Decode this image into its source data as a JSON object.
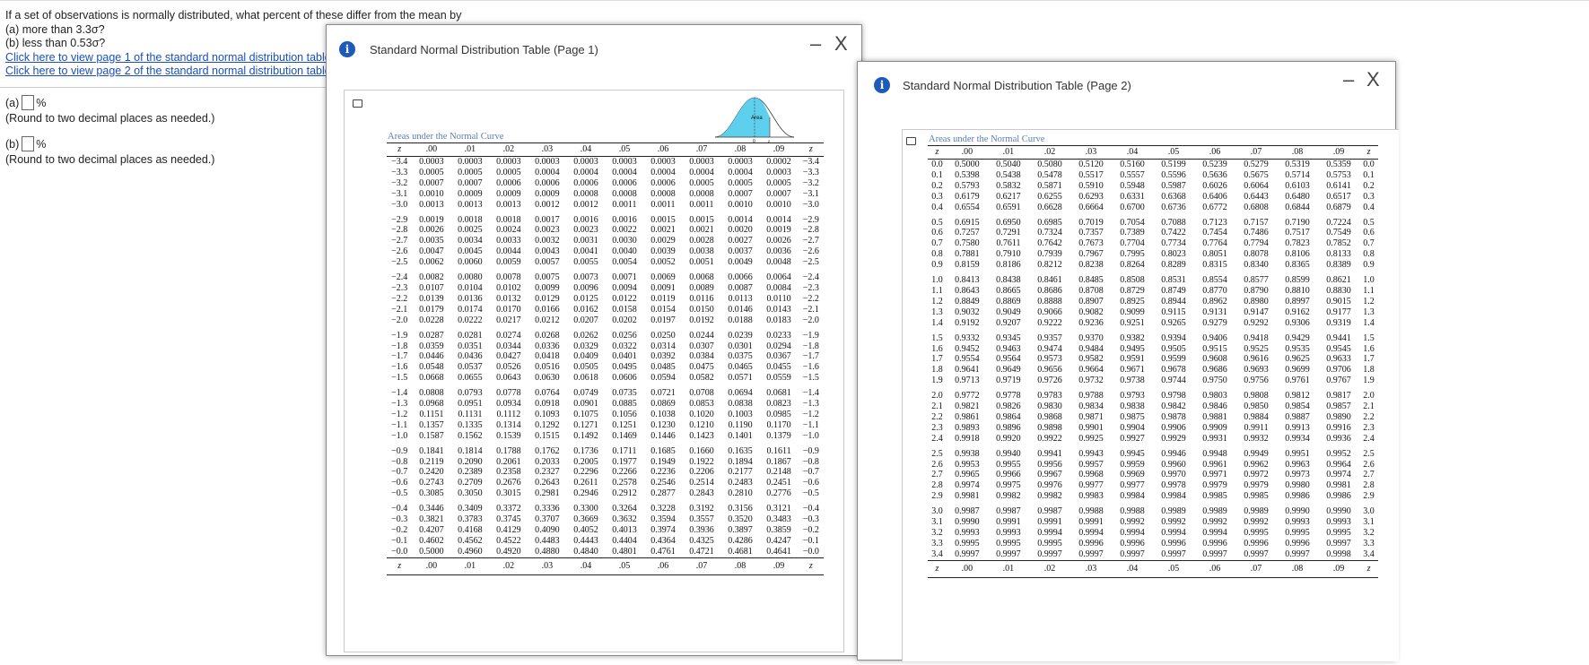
{
  "question": {
    "text": "If a set of observations is normally distributed, what percent of these differ from the mean by",
    "part_a": "(a) more than 3.3σ?",
    "part_b": "(b) less than 0.53σ?",
    "link1": "Click here to view page 1 of the standard normal distribution table.",
    "link2": "Click here to view page 2 of the standard normal distribution table."
  },
  "answers": [
    {
      "label": "(a)",
      "value": "",
      "unit": "%",
      "hint": "(Round to two decimal places as needed.)"
    },
    {
      "label": "(b)",
      "value": "",
      "unit": "%",
      "hint": "(Round to two decimal places as needed.)"
    }
  ],
  "windows": {
    "page1": {
      "title": "Standard Normal Distribution Table (Page 1)",
      "minimize": "–",
      "close": "X",
      "info": "i"
    },
    "page2": {
      "title": "Standard Normal Distribution Table (Page 2)",
      "minimize": "–",
      "close": "X",
      "info": "i"
    }
  },
  "table1": {
    "caption": "Areas under the Normal Curve",
    "curve_area_label": "Area",
    "curve_axis_0": "0",
    "curve_axis_z": "z",
    "headers": [
      "z",
      ".00",
      ".01",
      ".02",
      ".03",
      ".04",
      ".05",
      ".06",
      ".07",
      ".08",
      ".09",
      "z"
    ],
    "rows": [
      [
        "−3.4",
        "0.0003",
        "0.0003",
        "0.0003",
        "0.0003",
        "0.0003",
        "0.0003",
        "0.0003",
        "0.0003",
        "0.0003",
        "0.0002",
        "−3.4"
      ],
      [
        "−3.3",
        "0.0005",
        "0.0005",
        "0.0005",
        "0.0004",
        "0.0004",
        "0.0004",
        "0.0004",
        "0.0004",
        "0.0004",
        "0.0003",
        "−3.3"
      ],
      [
        "−3.2",
        "0.0007",
        "0.0007",
        "0.0006",
        "0.0006",
        "0.0006",
        "0.0006",
        "0.0006",
        "0.0005",
        "0.0005",
        "0.0005",
        "−3.2"
      ],
      [
        "−3.1",
        "0.0010",
        "0.0009",
        "0.0009",
        "0.0009",
        "0.0008",
        "0.0008",
        "0.0008",
        "0.0008",
        "0.0007",
        "0.0007",
        "−3.1"
      ],
      [
        "−3.0",
        "0.0013",
        "0.0013",
        "0.0013",
        "0.0012",
        "0.0012",
        "0.0011",
        "0.0011",
        "0.0011",
        "0.0010",
        "0.0010",
        "−3.0"
      ],
      [
        "−2.9",
        "0.0019",
        "0.0018",
        "0.0018",
        "0.0017",
        "0.0016",
        "0.0016",
        "0.0015",
        "0.0015",
        "0.0014",
        "0.0014",
        "−2.9"
      ],
      [
        "−2.8",
        "0.0026",
        "0.0025",
        "0.0024",
        "0.0023",
        "0.0023",
        "0.0022",
        "0.0021",
        "0.0021",
        "0.0020",
        "0.0019",
        "−2.8"
      ],
      [
        "−2.7",
        "0.0035",
        "0.0034",
        "0.0033",
        "0.0032",
        "0.0031",
        "0.0030",
        "0.0029",
        "0.0028",
        "0.0027",
        "0.0026",
        "−2.7"
      ],
      [
        "−2.6",
        "0.0047",
        "0.0045",
        "0.0044",
        "0.0043",
        "0.0041",
        "0.0040",
        "0.0039",
        "0.0038",
        "0.0037",
        "0.0036",
        "−2.6"
      ],
      [
        "−2.5",
        "0.0062",
        "0.0060",
        "0.0059",
        "0.0057",
        "0.0055",
        "0.0054",
        "0.0052",
        "0.0051",
        "0.0049",
        "0.0048",
        "−2.5"
      ],
      [
        "−2.4",
        "0.0082",
        "0.0080",
        "0.0078",
        "0.0075",
        "0.0073",
        "0.0071",
        "0.0069",
        "0.0068",
        "0.0066",
        "0.0064",
        "−2.4"
      ],
      [
        "−2.3",
        "0.0107",
        "0.0104",
        "0.0102",
        "0.0099",
        "0.0096",
        "0.0094",
        "0.0091",
        "0.0089",
        "0.0087",
        "0.0084",
        "−2.3"
      ],
      [
        "−2.2",
        "0.0139",
        "0.0136",
        "0.0132",
        "0.0129",
        "0.0125",
        "0.0122",
        "0.0119",
        "0.0116",
        "0.0113",
        "0.0110",
        "−2.2"
      ],
      [
        "−2.1",
        "0.0179",
        "0.0174",
        "0.0170",
        "0.0166",
        "0.0162",
        "0.0158",
        "0.0154",
        "0.0150",
        "0.0146",
        "0.0143",
        "−2.1"
      ],
      [
        "−2.0",
        "0.0228",
        "0.0222",
        "0.0217",
        "0.0212",
        "0.0207",
        "0.0202",
        "0.0197",
        "0.0192",
        "0.0188",
        "0.0183",
        "−2.0"
      ],
      [
        "−1.9",
        "0.0287",
        "0.0281",
        "0.0274",
        "0.0268",
        "0.0262",
        "0.0256",
        "0.0250",
        "0.0244",
        "0.0239",
        "0.0233",
        "−1.9"
      ],
      [
        "−1.8",
        "0.0359",
        "0.0351",
        "0.0344",
        "0.0336",
        "0.0329",
        "0.0322",
        "0.0314",
        "0.0307",
        "0.0301",
        "0.0294",
        "−1.8"
      ],
      [
        "−1.7",
        "0.0446",
        "0.0436",
        "0.0427",
        "0.0418",
        "0.0409",
        "0.0401",
        "0.0392",
        "0.0384",
        "0.0375",
        "0.0367",
        "−1.7"
      ],
      [
        "−1.6",
        "0.0548",
        "0.0537",
        "0.0526",
        "0.0516",
        "0.0505",
        "0.0495",
        "0.0485",
        "0.0475",
        "0.0465",
        "0.0455",
        "−1.6"
      ],
      [
        "−1.5",
        "0.0668",
        "0.0655",
        "0.0643",
        "0.0630",
        "0.0618",
        "0.0606",
        "0.0594",
        "0.0582",
        "0.0571",
        "0.0559",
        "−1.5"
      ],
      [
        "−1.4",
        "0.0808",
        "0.0793",
        "0.0778",
        "0.0764",
        "0.0749",
        "0.0735",
        "0.0721",
        "0.0708",
        "0.0694",
        "0.0681",
        "−1.4"
      ],
      [
        "−1.3",
        "0.0968",
        "0.0951",
        "0.0934",
        "0.0918",
        "0.0901",
        "0.0885",
        "0.0869",
        "0.0853",
        "0.0838",
        "0.0823",
        "−1.3"
      ],
      [
        "−1.2",
        "0.1151",
        "0.1131",
        "0.1112",
        "0.1093",
        "0.1075",
        "0.1056",
        "0.1038",
        "0.1020",
        "0.1003",
        "0.0985",
        "−1.2"
      ],
      [
        "−1.1",
        "0.1357",
        "0.1335",
        "0.1314",
        "0.1292",
        "0.1271",
        "0.1251",
        "0.1230",
        "0.1210",
        "0.1190",
        "0.1170",
        "−1.1"
      ],
      [
        "−1.0",
        "0.1587",
        "0.1562",
        "0.1539",
        "0.1515",
        "0.1492",
        "0.1469",
        "0.1446",
        "0.1423",
        "0.1401",
        "0.1379",
        "−1.0"
      ],
      [
        "−0.9",
        "0.1841",
        "0.1814",
        "0.1788",
        "0.1762",
        "0.1736",
        "0.1711",
        "0.1685",
        "0.1660",
        "0.1635",
        "0.1611",
        "−0.9"
      ],
      [
        "−0.8",
        "0.2119",
        "0.2090",
        "0.2061",
        "0.2033",
        "0.2005",
        "0.1977",
        "0.1949",
        "0.1922",
        "0.1894",
        "0.1867",
        "−0.8"
      ],
      [
        "−0.7",
        "0.2420",
        "0.2389",
        "0.2358",
        "0.2327",
        "0.2296",
        "0.2266",
        "0.2236",
        "0.2206",
        "0.2177",
        "0.2148",
        "−0.7"
      ],
      [
        "−0.6",
        "0.2743",
        "0.2709",
        "0.2676",
        "0.2643",
        "0.2611",
        "0.2578",
        "0.2546",
        "0.2514",
        "0.2483",
        "0.2451",
        "−0.6"
      ],
      [
        "−0.5",
        "0.3085",
        "0.3050",
        "0.3015",
        "0.2981",
        "0.2946",
        "0.2912",
        "0.2877",
        "0.2843",
        "0.2810",
        "0.2776",
        "−0.5"
      ],
      [
        "−0.4",
        "0.3446",
        "0.3409",
        "0.3372",
        "0.3336",
        "0.3300",
        "0.3264",
        "0.3228",
        "0.3192",
        "0.3156",
        "0.3121",
        "−0.4"
      ],
      [
        "−0.3",
        "0.3821",
        "0.3783",
        "0.3745",
        "0.3707",
        "0.3669",
        "0.3632",
        "0.3594",
        "0.3557",
        "0.3520",
        "0.3483",
        "−0.3"
      ],
      [
        "−0.2",
        "0.4207",
        "0.4168",
        "0.4129",
        "0.4090",
        "0.4052",
        "0.4013",
        "0.3974",
        "0.3936",
        "0.3897",
        "0.3859",
        "−0.2"
      ],
      [
        "−0.1",
        "0.4602",
        "0.4562",
        "0.4522",
        "0.4483",
        "0.4443",
        "0.4404",
        "0.4364",
        "0.4325",
        "0.4286",
        "0.4247",
        "−0.1"
      ],
      [
        "−0.0",
        "0.5000",
        "0.4960",
        "0.4920",
        "0.4880",
        "0.4840",
        "0.4801",
        "0.4761",
        "0.4721",
        "0.4681",
        "0.4641",
        "−0.0"
      ]
    ]
  },
  "table2": {
    "caption": "Areas under the Normal Curve",
    "headers": [
      "z",
      ".00",
      ".01",
      ".02",
      ".03",
      ".04",
      ".05",
      ".06",
      ".07",
      ".08",
      ".09",
      "z"
    ],
    "rows": [
      [
        "0.0",
        "0.5000",
        "0.5040",
        "0.5080",
        "0.5120",
        "0.5160",
        "0.5199",
        "0.5239",
        "0.5279",
        "0.5319",
        "0.5359",
        "0.0"
      ],
      [
        "0.1",
        "0.5398",
        "0.5438",
        "0.5478",
        "0.5517",
        "0.5557",
        "0.5596",
        "0.5636",
        "0.5675",
        "0.5714",
        "0.5753",
        "0.1"
      ],
      [
        "0.2",
        "0.5793",
        "0.5832",
        "0.5871",
        "0.5910",
        "0.5948",
        "0.5987",
        "0.6026",
        "0.6064",
        "0.6103",
        "0.6141",
        "0.2"
      ],
      [
        "0.3",
        "0.6179",
        "0.6217",
        "0.6255",
        "0.6293",
        "0.6331",
        "0.6368",
        "0.6406",
        "0.6443",
        "0.6480",
        "0.6517",
        "0.3"
      ],
      [
        "0.4",
        "0.6554",
        "0.6591",
        "0.6628",
        "0.6664",
        "0.6700",
        "0.6736",
        "0.6772",
        "0.6808",
        "0.6844",
        "0.6879",
        "0.4"
      ],
      [
        "0.5",
        "0.6915",
        "0.6950",
        "0.6985",
        "0.7019",
        "0.7054",
        "0.7088",
        "0.7123",
        "0.7157",
        "0.7190",
        "0.7224",
        "0.5"
      ],
      [
        "0.6",
        "0.7257",
        "0.7291",
        "0.7324",
        "0.7357",
        "0.7389",
        "0.7422",
        "0.7454",
        "0.7486",
        "0.7517",
        "0.7549",
        "0.6"
      ],
      [
        "0.7",
        "0.7580",
        "0.7611",
        "0.7642",
        "0.7673",
        "0.7704",
        "0.7734",
        "0.7764",
        "0.7794",
        "0.7823",
        "0.7852",
        "0.7"
      ],
      [
        "0.8",
        "0.7881",
        "0.7910",
        "0.7939",
        "0.7967",
        "0.7995",
        "0.8023",
        "0.8051",
        "0.8078",
        "0.8106",
        "0.8133",
        "0.8"
      ],
      [
        "0.9",
        "0.8159",
        "0.8186",
        "0.8212",
        "0.8238",
        "0.8264",
        "0.8289",
        "0.8315",
        "0.8340",
        "0.8365",
        "0.8389",
        "0.9"
      ],
      [
        "1.0",
        "0.8413",
        "0.8438",
        "0.8461",
        "0.8485",
        "0.8508",
        "0.8531",
        "0.8554",
        "0.8577",
        "0.8599",
        "0.8621",
        "1.0"
      ],
      [
        "1.1",
        "0.8643",
        "0.8665",
        "0.8686",
        "0.8708",
        "0.8729",
        "0.8749",
        "0.8770",
        "0.8790",
        "0.8810",
        "0.8830",
        "1.1"
      ],
      [
        "1.2",
        "0.8849",
        "0.8869",
        "0.8888",
        "0.8907",
        "0.8925",
        "0.8944",
        "0.8962",
        "0.8980",
        "0.8997",
        "0.9015",
        "1.2"
      ],
      [
        "1.3",
        "0.9032",
        "0.9049",
        "0.9066",
        "0.9082",
        "0.9099",
        "0.9115",
        "0.9131",
        "0.9147",
        "0.9162",
        "0.9177",
        "1.3"
      ],
      [
        "1.4",
        "0.9192",
        "0.9207",
        "0.9222",
        "0.9236",
        "0.9251",
        "0.9265",
        "0.9279",
        "0.9292",
        "0.9306",
        "0.9319",
        "1.4"
      ],
      [
        "1.5",
        "0.9332",
        "0.9345",
        "0.9357",
        "0.9370",
        "0.9382",
        "0.9394",
        "0.9406",
        "0.9418",
        "0.9429",
        "0.9441",
        "1.5"
      ],
      [
        "1.6",
        "0.9452",
        "0.9463",
        "0.9474",
        "0.9484",
        "0.9495",
        "0.9505",
        "0.9515",
        "0.9525",
        "0.9535",
        "0.9545",
        "1.6"
      ],
      [
        "1.7",
        "0.9554",
        "0.9564",
        "0.9573",
        "0.9582",
        "0.9591",
        "0.9599",
        "0.9608",
        "0.9616",
        "0.9625",
        "0.9633",
        "1.7"
      ],
      [
        "1.8",
        "0.9641",
        "0.9649",
        "0.9656",
        "0.9664",
        "0.9671",
        "0.9678",
        "0.9686",
        "0.9693",
        "0.9699",
        "0.9706",
        "1.8"
      ],
      [
        "1.9",
        "0.9713",
        "0.9719",
        "0.9726",
        "0.9732",
        "0.9738",
        "0.9744",
        "0.9750",
        "0.9756",
        "0.9761",
        "0.9767",
        "1.9"
      ],
      [
        "2.0",
        "0.9772",
        "0.9778",
        "0.9783",
        "0.9788",
        "0.9793",
        "0.9798",
        "0.9803",
        "0.9808",
        "0.9812",
        "0.9817",
        "2.0"
      ],
      [
        "2.1",
        "0.9821",
        "0.9826",
        "0.9830",
        "0.9834",
        "0.9838",
        "0.9842",
        "0.9846",
        "0.9850",
        "0.9854",
        "0.9857",
        "2.1"
      ],
      [
        "2.2",
        "0.9861",
        "0.9864",
        "0.9868",
        "0.9871",
        "0.9875",
        "0.9878",
        "0.9881",
        "0.9884",
        "0.9887",
        "0.9890",
        "2.2"
      ],
      [
        "2.3",
        "0.9893",
        "0.9896",
        "0.9898",
        "0.9901",
        "0.9904",
        "0.9906",
        "0.9909",
        "0.9911",
        "0.9913",
        "0.9916",
        "2.3"
      ],
      [
        "2.4",
        "0.9918",
        "0.9920",
        "0.9922",
        "0.9925",
        "0.9927",
        "0.9929",
        "0.9931",
        "0.9932",
        "0.9934",
        "0.9936",
        "2.4"
      ],
      [
        "2.5",
        "0.9938",
        "0.9940",
        "0.9941",
        "0.9943",
        "0.9945",
        "0.9946",
        "0.9948",
        "0.9949",
        "0.9951",
        "0.9952",
        "2.5"
      ],
      [
        "2.6",
        "0.9953",
        "0.9955",
        "0.9956",
        "0.9957",
        "0.9959",
        "0.9960",
        "0.9961",
        "0.9962",
        "0.9963",
        "0.9964",
        "2.6"
      ],
      [
        "2.7",
        "0.9965",
        "0.9966",
        "0.9967",
        "0.9968",
        "0.9969",
        "0.9970",
        "0.9971",
        "0.9972",
        "0.9973",
        "0.9974",
        "2.7"
      ],
      [
        "2.8",
        "0.9974",
        "0.9975",
        "0.9976",
        "0.9977",
        "0.9977",
        "0.9978",
        "0.9979",
        "0.9979",
        "0.9980",
        "0.9981",
        "2.8"
      ],
      [
        "2.9",
        "0.9981",
        "0.9982",
        "0.9982",
        "0.9983",
        "0.9984",
        "0.9984",
        "0.9985",
        "0.9985",
        "0.9986",
        "0.9986",
        "2.9"
      ],
      [
        "3.0",
        "0.9987",
        "0.9987",
        "0.9987",
        "0.9988",
        "0.9988",
        "0.9989",
        "0.9989",
        "0.9989",
        "0.9990",
        "0.9990",
        "3.0"
      ],
      [
        "3.1",
        "0.9990",
        "0.9991",
        "0.9991",
        "0.9991",
        "0.9992",
        "0.9992",
        "0.9992",
        "0.9992",
        "0.9993",
        "0.9993",
        "3.1"
      ],
      [
        "3.2",
        "0.9993",
        "0.9993",
        "0.9994",
        "0.9994",
        "0.9994",
        "0.9994",
        "0.9994",
        "0.9995",
        "0.9995",
        "0.9995",
        "3.2"
      ],
      [
        "3.3",
        "0.9995",
        "0.9995",
        "0.9995",
        "0.9996",
        "0.9996",
        "0.9996",
        "0.9996",
        "0.9996",
        "0.9996",
        "0.9997",
        "3.3"
      ],
      [
        "3.4",
        "0.9997",
        "0.9997",
        "0.9997",
        "0.9997",
        "0.9997",
        "0.9997",
        "0.9997",
        "0.9997",
        "0.9997",
        "0.9998",
        "3.4"
      ]
    ]
  },
  "colors": {
    "link": "#1a4fbf",
    "info_icon": "#1e5bb8",
    "caption": "#5a7db5",
    "curve_fill": "#5ed0ee"
  }
}
